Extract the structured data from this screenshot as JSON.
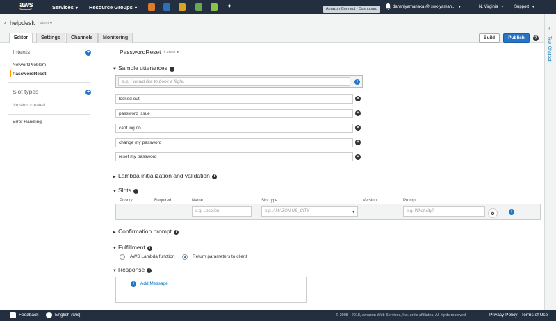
{
  "nav": {
    "services": "Services",
    "resource_groups": "Resource Groups",
    "dashboard_badge": "Amazon Connect - Dashboard",
    "user": "danshiyamanaka @ swx-yaman...",
    "region": "N. Virginia",
    "support": "Support"
  },
  "header": {
    "bot_name": "helpdesk",
    "bot_version": "Latest",
    "tabs": [
      "Editor",
      "Settings",
      "Channels",
      "Monitoring"
    ],
    "build": "Build",
    "publish": "Publish"
  },
  "rail": {
    "label": "Test Chatbot"
  },
  "sidebar": {
    "intents_title": "Intents",
    "intents": [
      "NetworkProblem",
      "PasswordReset"
    ],
    "slot_types_title": "Slot types",
    "no_slots": "No slots created",
    "error_handling": "Error Handling"
  },
  "main": {
    "intent_name": "PasswordReset",
    "intent_version": "Latest",
    "sample_utterances_title": "Sample utterances",
    "utterance_placeholder": "e.g. I would like to book a flight.",
    "utterances": [
      "locked out",
      "password issue",
      "cant log on",
      "change my password",
      "reset my password"
    ],
    "lambda_title": "Lambda initialization and validation",
    "slots_title": "Slots",
    "slot_columns": [
      "Priority",
      "Required",
      "Name",
      "Slot type",
      "Version",
      "Prompt"
    ],
    "slot_name_placeholder": "e.g. Location",
    "slot_type_placeholder": "e.g. AMAZON.US_CITY",
    "slot_prompt_placeholder": "e.g. What city?",
    "confirmation_title": "Confirmation prompt",
    "fulfillment_title": "Fulfillment",
    "fulfillment_options": [
      "AWS Lambda function",
      "Return parameters to client"
    ],
    "fulfillment_selected": 1,
    "response_title": "Response",
    "add_message": "Add Message"
  },
  "footer": {
    "feedback": "Feedback",
    "language": "English (US)",
    "copyright": "© 2008 - 2018, Amazon Web Services, Inc. or its affiliates. All rights reserved.",
    "privacy": "Privacy Policy",
    "terms": "Terms of Use"
  },
  "colors": {
    "nav_bg": "#232f3e",
    "accent": "#2475c5",
    "selected": "#ff9900"
  }
}
